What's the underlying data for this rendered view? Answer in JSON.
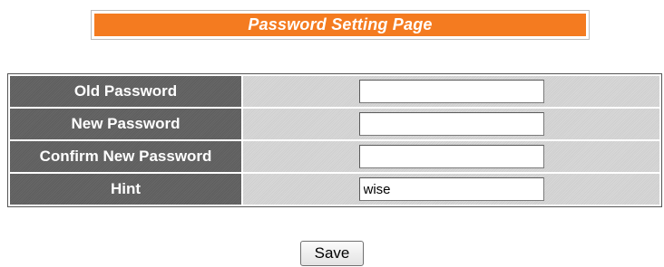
{
  "page": {
    "title": "Password Setting Page"
  },
  "form": {
    "rows": [
      {
        "label": "Old Password",
        "value": ""
      },
      {
        "label": "New Password",
        "value": ""
      },
      {
        "label": "Confirm New Password",
        "value": ""
      },
      {
        "label": "Hint",
        "value": "wise"
      }
    ]
  },
  "actions": {
    "save_label": "Save"
  },
  "colors": {
    "title_background": "#f47b20",
    "label_background": "#5e5e5e",
    "value_background": "#cfcfcf"
  }
}
